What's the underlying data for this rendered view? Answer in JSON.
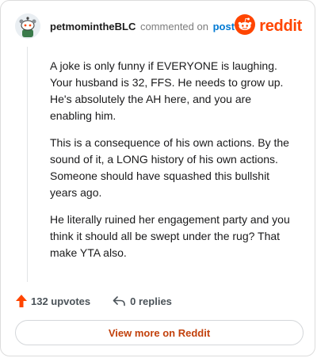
{
  "header": {
    "username": "petmomintheBLC",
    "commented_text": "commented on",
    "post_link": "post",
    "brand_name": "reddit",
    "brand_color": "#ff4500"
  },
  "comment": {
    "paragraphs": [
      "A joke is only funny if EVERYONE is laughing. Your husband is 32, FFS. He needs to grow up. He's absolutely the AH here, and you are enabling him.",
      "This is a consequence of his own actions. By the sound of it, a LONG history of his own actions. Someone should have squashed this bullshit years ago.",
      "He literally ruined her engagement party and you think it should all be swept under the rug? That make YTA also."
    ]
  },
  "actions": {
    "upvotes": "132 upvotes",
    "replies": "0 replies",
    "upvote_color": "#ff4500"
  },
  "footer": {
    "view_more": "View more on Reddit"
  },
  "icons": [
    "snoo-avatar-icon",
    "reddit-logo-icon",
    "upvote-arrow-icon",
    "reply-arrow-icon"
  ]
}
